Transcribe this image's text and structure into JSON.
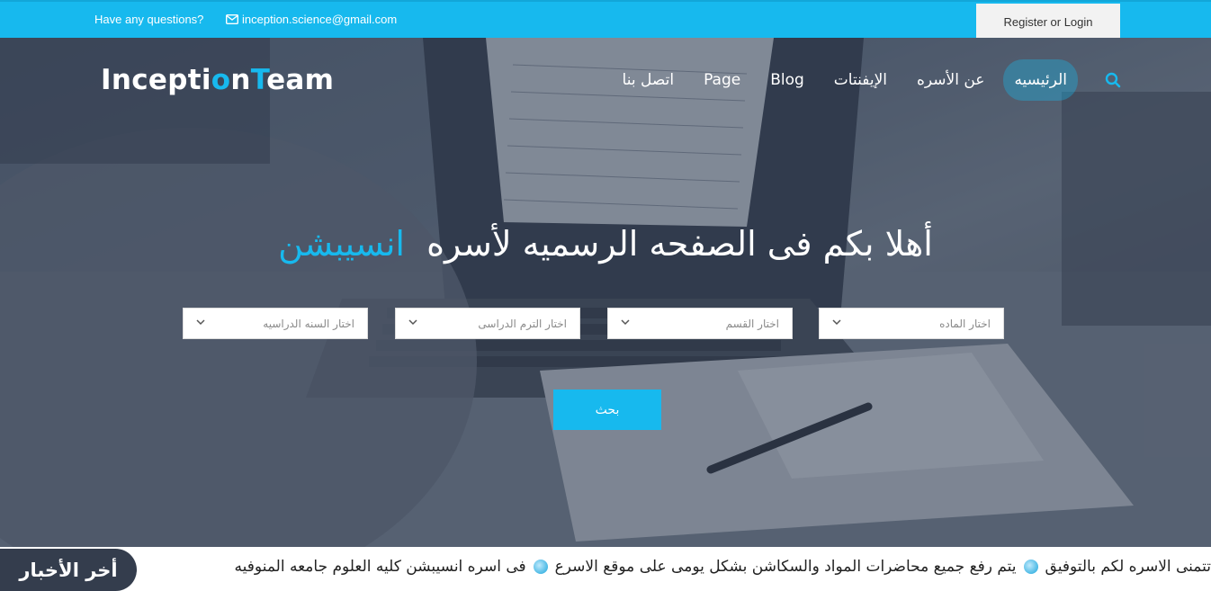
{
  "topbar": {
    "question": "Have any questions?",
    "email": "inception.science@gmail.com",
    "login": "Register or Login"
  },
  "brand": {
    "part1": "Incepti",
    "part2": "o",
    "part3": "n",
    "part4": "T",
    "part5": "eam"
  },
  "nav": {
    "items": [
      {
        "label": "الرئيسيه",
        "active": true
      },
      {
        "label": "عن الأسره"
      },
      {
        "label": "الإيفنتات"
      },
      {
        "label": "Blog"
      },
      {
        "label": "Page"
      },
      {
        "label": "اتصل بنا"
      }
    ],
    "search_icon": "search-icon"
  },
  "hero": {
    "headline_main": "أهلا بكم فى الصفحه الرسميه لأسره",
    "headline_accent": "انسيبشن",
    "selects": [
      {
        "placeholder": "اختار الماده"
      },
      {
        "placeholder": "اختار القسم"
      },
      {
        "placeholder": "اختار الترم الدراسى"
      },
      {
        "placeholder": "اختار السنه الدراسيه"
      }
    ],
    "search_button": "بحث"
  },
  "ticker": {
    "label": "أخر الأخبار",
    "items": [
      "تتمنى الاسره لكم بالتوفيق",
      "يتم رفع جميع محاضرات المواد والسكاشن بشكل يومى على موقع الاسرع",
      "فى اسره انسيبشن كليه العلوم جامعه المنوفيه"
    ]
  },
  "colors": {
    "accent": "#17b9ee",
    "ticker_label_bg": "#343d4d"
  }
}
